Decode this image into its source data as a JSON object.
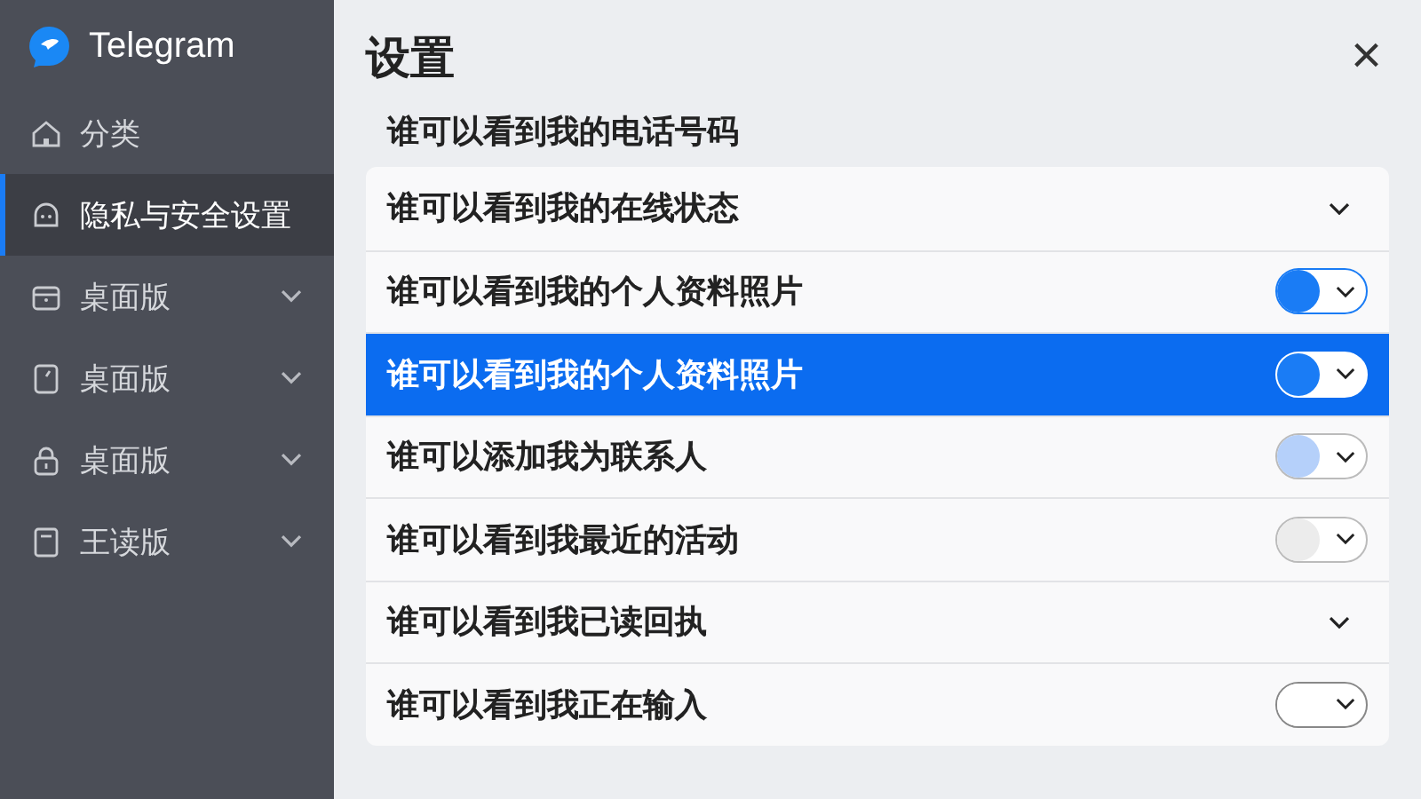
{
  "app": {
    "name": "Telegram"
  },
  "sidebar": {
    "items": [
      {
        "label": "分类",
        "selected": false,
        "expandable": false
      },
      {
        "label": "隐私与安全设置",
        "selected": true,
        "expandable": false
      },
      {
        "label": "桌面版",
        "selected": false,
        "expandable": true
      },
      {
        "label": "桌面版",
        "selected": false,
        "expandable": true
      },
      {
        "label": "桌面版",
        "selected": false,
        "expandable": true
      },
      {
        "label": "王读版",
        "selected": false,
        "expandable": true
      }
    ]
  },
  "page": {
    "title": "设置",
    "close": "×"
  },
  "section": {
    "heading": "谁可以看到我的电话号码"
  },
  "rows": [
    {
      "kind": "dropdown",
      "label": "谁可以看到我的在线状态",
      "selected": false
    },
    {
      "kind": "toggle",
      "label": "谁可以看到我的个人资料照片",
      "selected": false,
      "color": "#1a7cf5"
    },
    {
      "kind": "toggle",
      "label": "谁可以看到我的个人资料照片",
      "selected": true,
      "color": "#1a7cf5"
    },
    {
      "kind": "toggle",
      "label": "谁可以添加我为联系人",
      "selected": false,
      "color": "#b5d0fa"
    },
    {
      "kind": "toggle",
      "label": "谁可以看到我最近的活动",
      "selected": false,
      "color": "#ececec"
    },
    {
      "kind": "dropdown",
      "label": "谁可以看到我已读回执",
      "selected": false
    },
    {
      "kind": "toggle",
      "label": "谁可以看到我正在输入",
      "selected": false,
      "color": "#ffffff"
    }
  ]
}
